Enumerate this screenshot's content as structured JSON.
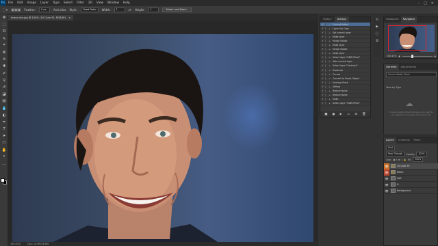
{
  "menubar": {
    "logo": "Ps",
    "items": [
      "File",
      "Edit",
      "Image",
      "Layer",
      "Type",
      "Select",
      "Filter",
      "3D",
      "View",
      "Window",
      "Help"
    ],
    "controls": [
      "–",
      "□",
      "✕"
    ]
  },
  "options": {
    "feather_label": "Feather:",
    "feather_value": "0 px",
    "antialias_label": "Anti-alias",
    "style_label": "Style:",
    "style_value": "Fixed Ratio",
    "width_label": "Width:",
    "width_value": "1",
    "height_label": "Height:",
    "height_value": "1",
    "select_mask_label": "Select and Mask..."
  },
  "document": {
    "tab_title": "tomcruise.jpg @ 100% (10 Color Fil, RGB/8*)",
    "close_glyph": "×"
  },
  "status": {
    "zoom": "100.41%",
    "doc_size": "Doc: 14.9M/26.8M"
  },
  "actions_panel": {
    "tabs": [
      "History",
      "Actions"
    ],
    "rows": [
      "Current Action",
      "Layer Via Copy",
      "Set current layer",
      "Make layer",
      "Merge Visible",
      "Make layer",
      "Merge Visible",
      "Make layer",
      "Select layer \"HDR Effect\"",
      "Hide current layer",
      "Select layer \"Contrast\"",
      "Duplicate",
      "Curves",
      "Convert to Smart Object",
      "Unsharp Mask",
      "Diffuse",
      "Reduce Noise",
      "Reduce Noise",
      "Make",
      "Select layer \"HDR Effect\""
    ],
    "footer_icons": [
      "■",
      "●",
      "▶",
      "▭",
      "⊞",
      "🗑"
    ]
  },
  "nav_panel": {
    "tabs": [
      "Histogram",
      "Navigator"
    ],
    "zoom": "100.41%"
  },
  "libraries_panel": {
    "tabs": [
      "Libraries",
      "Adjustments"
    ],
    "search_placeholder": "Search Adobe Stock",
    "view_by": "View by Type",
    "message": "To use Creative Cloud Libraries, you need to be logged in to Creative Cloud account."
  },
  "layers_panel": {
    "tabs": [
      "Layers",
      "Channels",
      "Paths"
    ],
    "kind_label": "Kind",
    "blend_mode": "Pass Through",
    "opacity_label": "Opacity:",
    "opacity_value": "100%",
    "lock_label": "Lock:",
    "fill_label": "Fill:",
    "fill_value": "100%",
    "layers": [
      {
        "name": "10 Color Fil",
        "eye": "orange",
        "type": "group"
      },
      {
        "name": "Effect",
        "eye": "red",
        "type": "group"
      },
      {
        "name": "Soft",
        "eye": "normal",
        "type": "layer"
      },
      {
        "name": "H",
        "eye": "normal",
        "type": "layer"
      },
      {
        "name": "Background",
        "eye": "normal",
        "type": "layer"
      }
    ]
  },
  "toolbar": {
    "tools": [
      "move-icon",
      "marquee-icon",
      "lasso-icon",
      "quick-select-icon",
      "crop-icon",
      "frame-icon",
      "eyedropper-icon",
      "spot-heal-icon",
      "brush-icon",
      "clone-stamp-icon",
      "history-brush-icon",
      "eraser-icon",
      "gradient-icon",
      "blur-icon",
      "dodge-icon",
      "pen-icon",
      "type-icon",
      "path-select-icon",
      "rectangle-icon",
      "hand-icon",
      "zoom-icon",
      "more-tools-icon"
    ],
    "glyphs": [
      "✥",
      "⬚",
      "ʘ",
      "✎",
      "⌗",
      "⊠",
      "⊘",
      "✚",
      "✐",
      "⚲",
      "↺",
      "◪",
      "▤",
      "💧",
      "◐",
      "✒",
      "T",
      "➤",
      "▭",
      "✋",
      "⌕",
      "…"
    ]
  }
}
